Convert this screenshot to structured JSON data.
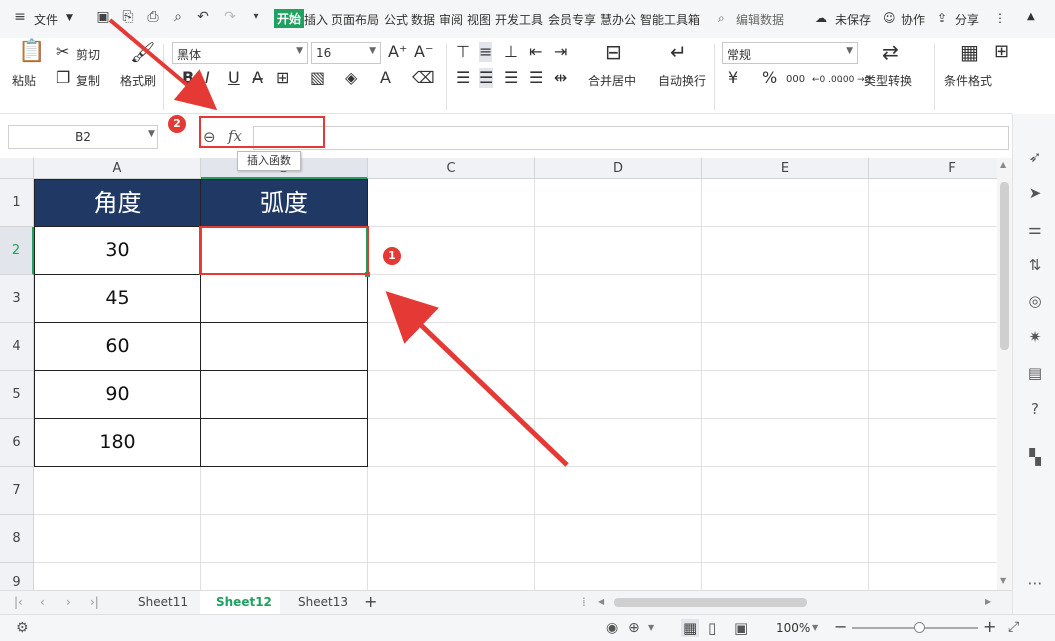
{
  "menubar": {
    "file_label": "文件",
    "tabs": [
      "开始",
      "插入",
      "页面布局",
      "公式",
      "数据",
      "审阅",
      "视图",
      "开发工具",
      "会员专享",
      "慧办公",
      "智能工具箱"
    ],
    "edit_data": "编辑数据",
    "unsaved": "未保存",
    "collab": "协作",
    "share": "分享"
  },
  "ribbon": {
    "paste": "粘贴",
    "cut": "剪切",
    "copy": "复制",
    "format_painter": "格式刷",
    "font_name": "黑体",
    "font_size": "16",
    "bold": "B",
    "italic": "I",
    "underline": "U",
    "merge_center": "合并居中",
    "wrap_text": "自动换行",
    "number_format": "常规",
    "currency": "¥",
    "percent": "%",
    "thousands": "000",
    "inc_decimal": "←0 .00",
    "dec_decimal": ".00 →0",
    "type_convert": "类型转换",
    "conditional_format": "条件格式"
  },
  "formula_bar": {
    "name_box": "B2",
    "fx": "fx",
    "value": "",
    "tooltip": "插入函数"
  },
  "columns": [
    "A",
    "B",
    "C",
    "D",
    "E",
    "F"
  ],
  "rows": [
    "1",
    "2",
    "3",
    "4",
    "5",
    "6",
    "7",
    "8",
    "9"
  ],
  "table": {
    "headers": [
      "角度",
      "弧度"
    ],
    "values": [
      "30",
      "45",
      "60",
      "90",
      "180"
    ]
  },
  "annotations": {
    "badge1": "1",
    "badge2": "2",
    "color": "#e53935"
  },
  "sheets": [
    "Sheet11",
    "Sheet12",
    "Sheet13"
  ],
  "active_sheet": "Sheet12",
  "status": {
    "zoom": "100%"
  },
  "colors": {
    "header_fill": "#1f3864",
    "accent": "#1fa15f"
  }
}
